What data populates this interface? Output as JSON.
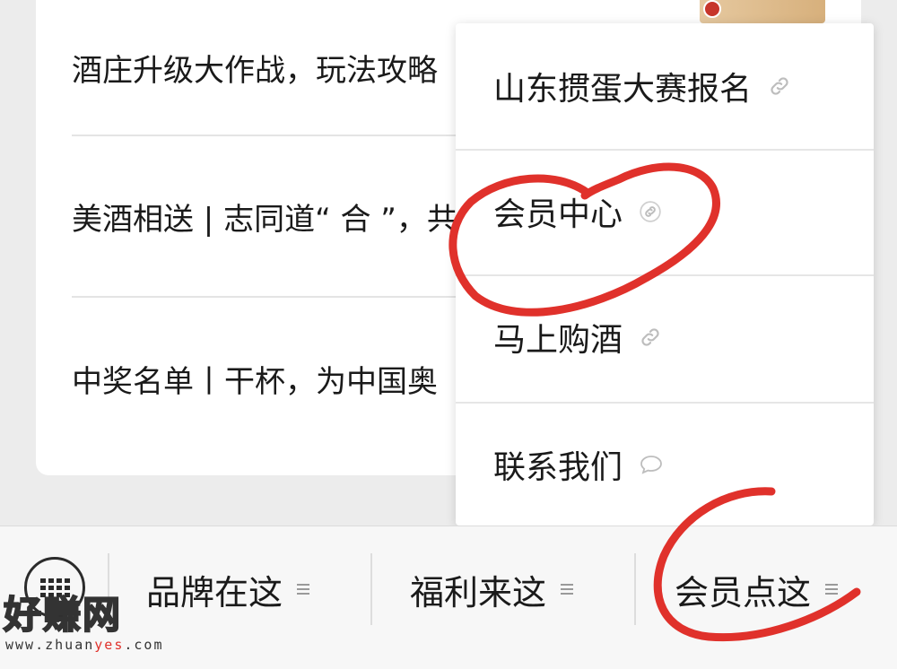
{
  "articles": [
    {
      "title": "酒庄升级大作战，玩法攻略"
    },
    {
      "title": "美酒相送 | 志同道“ 合 ”，共"
    },
    {
      "title": "中奖名单丨干杯，为中国奥"
    }
  ],
  "menu": {
    "items": [
      {
        "label": "山东掼蛋大赛报名",
        "icon": "link-icon"
      },
      {
        "label": "会员中心",
        "icon": "link-icon"
      },
      {
        "label": "马上购酒",
        "icon": "link-icon"
      },
      {
        "label": "联系我们",
        "icon": "chat-bubble-icon"
      }
    ]
  },
  "bottombar": {
    "keyboard_icon": "keyboard-icon",
    "tabs": [
      {
        "label": "品牌在这"
      },
      {
        "label": "福利来这"
      },
      {
        "label": "会员点这"
      }
    ]
  },
  "watermark": {
    "name": "好赚网",
    "url_prefix": "www.zhuan",
    "url_highlight": "yes",
    "url_suffix": ".com"
  },
  "colors": {
    "annotation_red": "#e0312b",
    "background": "#ececec",
    "card": "#ffffff"
  }
}
